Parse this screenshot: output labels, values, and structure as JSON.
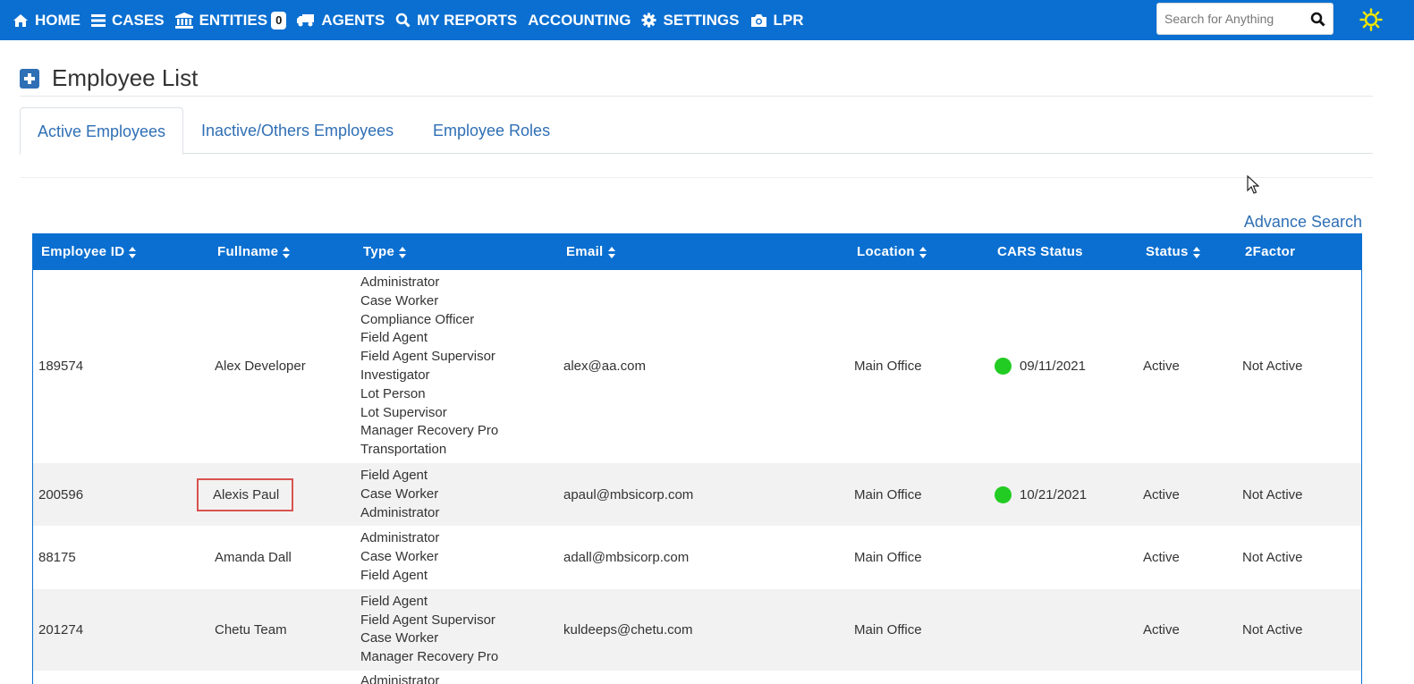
{
  "nav": {
    "items": [
      {
        "label": "HOME",
        "icon": "home-icon"
      },
      {
        "label": "CASES",
        "icon": "bars-icon"
      },
      {
        "label": "ENTITIES",
        "icon": "bank-icon",
        "badge": "0"
      },
      {
        "label": "AGENTS",
        "icon": "truck-icon"
      },
      {
        "label": "MY REPORTS",
        "icon": "search-icon"
      },
      {
        "label": "ACCOUNTING",
        "icon": ""
      },
      {
        "label": "SETTINGS",
        "icon": "gear-icon"
      },
      {
        "label": "LPR",
        "icon": "camera-icon"
      }
    ],
    "search_placeholder": "Search for Anything",
    "theme_icon": "sun-icon",
    "bar_color": "#0a6fd1"
  },
  "page": {
    "title": "Employee List",
    "tabs": [
      "Active Employees",
      "Inactive/Others Employees",
      "Employee Roles"
    ],
    "active_tab": "Active Employees",
    "advance_search": "Advance Search"
  },
  "table": {
    "headers": [
      "Employee ID",
      "Fullname",
      "Type",
      "Email",
      "Location",
      "CARS Status",
      "Status",
      "2Factor"
    ],
    "rows": [
      {
        "id": "189574",
        "fullname": "Alex Developer",
        "types": [
          "Administrator",
          "Case Worker",
          "Compliance Officer",
          "Field Agent",
          "Field Agent Supervisor",
          "Investigator",
          "Lot Person",
          "Lot Supervisor",
          "Manager Recovery Pro",
          "Transportation"
        ],
        "email": "alex@aa.com",
        "location": "Main Office",
        "cars_date": "09/11/2021",
        "status": "Active",
        "twofactor": "Not Active"
      },
      {
        "id": "200596",
        "fullname": "Alexis Paul",
        "types": [
          "Field Agent",
          "Case Worker",
          "Administrator"
        ],
        "email": "apaul@mbsicorp.com",
        "location": "Main Office",
        "cars_date": "10/21/2021",
        "status": "Active",
        "twofactor": "Not Active"
      },
      {
        "id": "88175",
        "fullname": "Amanda Dall",
        "types": [
          "Administrator",
          "Case Worker",
          "Field Agent"
        ],
        "email": "adall@mbsicorp.com",
        "location": "Main Office",
        "cars_date": "",
        "status": "Active",
        "twofactor": "Not Active"
      },
      {
        "id": "201274",
        "fullname": "Chetu Team",
        "types": [
          "Field Agent",
          "Field Agent Supervisor",
          "Case Worker",
          "Manager Recovery Pro"
        ],
        "email": "kuldeeps@chetu.com",
        "location": "Main Office",
        "cars_date": "",
        "status": "Active",
        "twofactor": "Not Active"
      },
      {
        "id": "",
        "fullname": "",
        "types": [
          "Administrator"
        ],
        "email": "",
        "location": "",
        "cars_date": "",
        "status": "",
        "twofactor": ""
      }
    ]
  }
}
